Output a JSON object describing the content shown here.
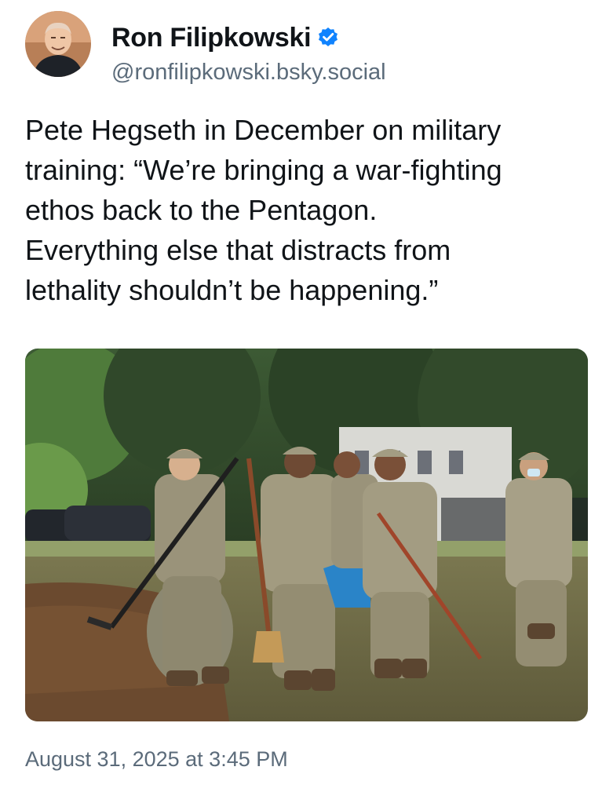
{
  "author": {
    "display_name": "Ron Filipkowski",
    "handle": "@ronfilipkowski.bsky.social",
    "verified_icon": "verified-badge-icon",
    "avatar_icon": "profile-photo"
  },
  "post": {
    "text": "Pete Hegseth in December on military\ntraining: “We’re bringing a war-fighting\nethos back to the Pentagon.\nEverything else that distracts from\nlethality shouldn’t be happening.”",
    "image": "photo-soldiers-raking-park",
    "timestamp": "August 31, 2025 at 3:45 PM"
  },
  "colors": {
    "text": "#101418",
    "muted": "#5b6b7a",
    "verified": "#1083fe"
  }
}
